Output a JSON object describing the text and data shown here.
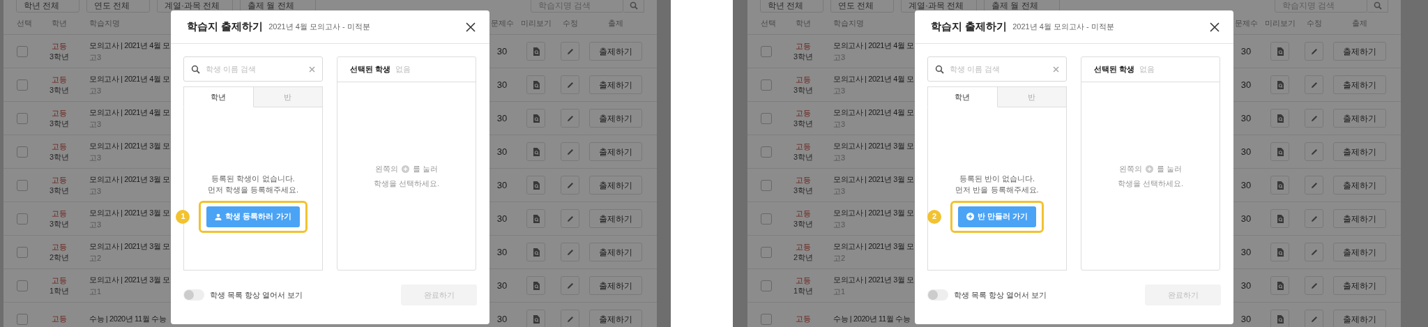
{
  "panels": [
    {
      "filters": [
        "학년 전체",
        "연도 전체",
        "계열·과목 전체",
        "출제 월 전체"
      ],
      "search": {
        "placeholder": "학습지명 검색"
      },
      "columns": [
        "선택",
        "학년",
        "학습지명",
        "문제수",
        "미리보기",
        "수정",
        "출제"
      ],
      "rows": [
        {
          "checked": false,
          "level": "고등",
          "grade": "3학년",
          "title": "모의고사 | 2021년 4월 모",
          "subtitle": "고3",
          "count": "30",
          "action": "출제하기"
        },
        {
          "checked": false,
          "level": "고등",
          "grade": "3학년",
          "title": "모의고사 | 2021년 4월 모",
          "subtitle": "고3",
          "count": "30",
          "action": "출제하기"
        },
        {
          "checked": false,
          "level": "고등",
          "grade": "3학년",
          "title": "모의고사 | 2021년 4월 모",
          "subtitle": "고3",
          "count": "30",
          "action": "출제하기"
        },
        {
          "checked": false,
          "level": "고등",
          "grade": "3학년",
          "title": "모의고사 | 2021년 3월 모",
          "subtitle": "고3",
          "count": "30",
          "action": "출제하기"
        },
        {
          "checked": false,
          "level": "고등",
          "grade": "3학년",
          "title": "모의고사 | 2021년 3월 모",
          "subtitle": "고3",
          "count": "30",
          "action": "출제하기"
        },
        {
          "checked": false,
          "level": "고등",
          "grade": "3학년",
          "title": "모의고사 | 2021년 3월 모",
          "subtitle": "고3",
          "count": "30",
          "action": "출제하기"
        },
        {
          "checked": false,
          "level": "고등",
          "grade": "2학년",
          "title": "모의고사 | 2021년 3월 모",
          "subtitle": "고2",
          "count": "30",
          "action": "출제하기"
        },
        {
          "checked": false,
          "level": "고등",
          "grade": "1학년",
          "title": "모의고사 | 2021년 3월 모",
          "subtitle": "고1",
          "count": "30",
          "action": "출제하기"
        },
        {
          "checked": false,
          "level": "고등",
          "title": "수능 | 2020년 11월 수능",
          "count": "30",
          "action": "출제하기"
        }
      ],
      "modal": {
        "title": "학습지 출제하기",
        "subtitle": "2021년 4월 모의고사 - 미적분",
        "search": {
          "placeholder": "학생 이름 검색"
        },
        "tabs": [
          {
            "label": "학년",
            "selected": true
          },
          {
            "label": "반",
            "selected": false
          }
        ],
        "empty_message": [
          "등록된 학생이 없습니다.",
          "먼저 학생을 등록해주세요."
        ],
        "step": "1",
        "action": {
          "label": "학생 등록하러 가기",
          "kind": "person"
        },
        "selected_panel": {
          "title": "선택된 학생",
          "count": "없음",
          "hint_before": "왼쪽의",
          "hint_after": "를 눌러",
          "hint_line2": "학생을 선택하세요."
        },
        "toggle": {
          "label": "학생 목록 항상 열어서 보기",
          "on": false
        },
        "submit": {
          "label": "완료하기",
          "disabled": true
        }
      }
    },
    {
      "filters": [
        "학년 전체",
        "연도 전체",
        "계열·과목 전체",
        "출제 월 전체"
      ],
      "search": {
        "placeholder": "학습지명 검색"
      },
      "columns": [
        "선택",
        "학년",
        "학습지명",
        "문제수",
        "미리보기",
        "수정",
        "출제"
      ],
      "rows": [
        {
          "checked": false,
          "level": "고등",
          "grade": "3학년",
          "title": "모의고사 | 2021년 4월 모",
          "subtitle": "고3",
          "count": "30",
          "action": "출제하기"
        },
        {
          "checked": false,
          "level": "고등",
          "grade": "3학년",
          "title": "모의고사 | 2021년 4월 모",
          "subtitle": "고3",
          "count": "30",
          "action": "출제하기"
        },
        {
          "checked": false,
          "level": "고등",
          "grade": "3학년",
          "title": "모의고사 | 2021년 4월 모",
          "subtitle": "고3",
          "count": "30",
          "action": "출제하기"
        },
        {
          "checked": false,
          "level": "고등",
          "grade": "3학년",
          "title": "모의고사 | 2021년 3월 모",
          "subtitle": "고3",
          "count": "30",
          "action": "출제하기"
        },
        {
          "checked": false,
          "level": "고등",
          "grade": "3학년",
          "title": "모의고사 | 2021년 3월 모",
          "subtitle": "고3",
          "count": "30",
          "action": "출제하기"
        },
        {
          "checked": false,
          "level": "고등",
          "grade": "3학년",
          "title": "모의고사 | 2021년 3월 모",
          "subtitle": "고3",
          "count": "30",
          "action": "출제하기"
        },
        {
          "checked": false,
          "level": "고등",
          "grade": "2학년",
          "title": "모의고사 | 2021년 3월 모",
          "subtitle": "고2",
          "count": "30",
          "action": "출제하기"
        },
        {
          "checked": false,
          "level": "고등",
          "grade": "1학년",
          "title": "모의고사 | 2021년 3월 모",
          "subtitle": "고1",
          "count": "30",
          "action": "출제하기"
        },
        {
          "checked": false,
          "level": "고등",
          "title": "수능 | 2020년 11월 수능",
          "count": "30",
          "action": "출제하기"
        }
      ],
      "modal": {
        "title": "학습지 출제하기",
        "subtitle": "2021년 4월 모의고사 - 미적분",
        "search": {
          "placeholder": "학생 이름 검색"
        },
        "tabs": [
          {
            "label": "학년",
            "selected": true
          },
          {
            "label": "반",
            "selected": false
          }
        ],
        "empty_message": [
          "등록된 반이 없습니다.",
          "먼저 반을 등록해주세요."
        ],
        "step": "2",
        "action": {
          "label": "반 만들러 가기",
          "kind": "plus"
        },
        "selected_panel": {
          "title": "선택된 학생",
          "count": "없음",
          "hint_before": "왼쪽의",
          "hint_after": "를 눌러",
          "hint_line2": "학생을 선택하세요."
        },
        "toggle": {
          "label": "학생 목록 항상 열어서 보기",
          "on": false
        },
        "submit": {
          "label": "완료하기",
          "disabled": true
        }
      }
    }
  ]
}
